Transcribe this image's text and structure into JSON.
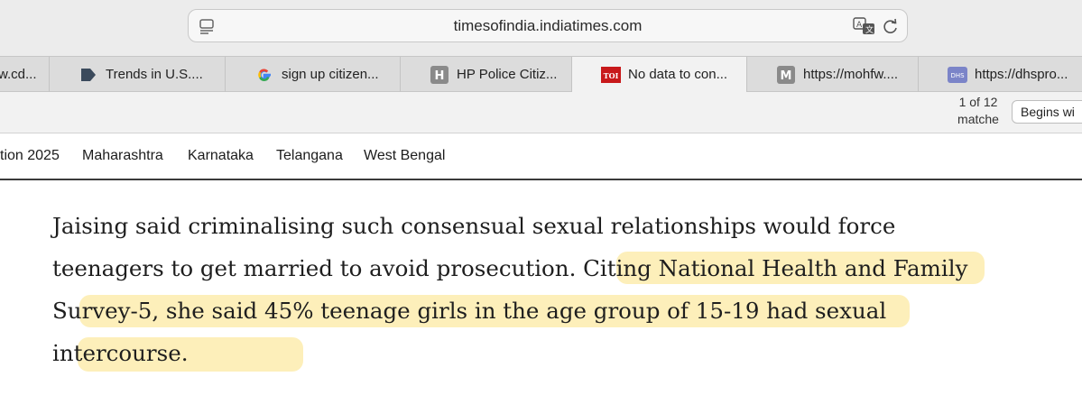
{
  "address_bar": {
    "url": "timesofindia.indiatimes.com"
  },
  "tabs": [
    {
      "label": "w.cd...",
      "icon": "",
      "active": false
    },
    {
      "label": "Trends in U.S....",
      "icon": "arrow-tag-icon",
      "active": false
    },
    {
      "label": "sign up citizen...",
      "icon": "google-icon",
      "active": false
    },
    {
      "label": "HP Police Citiz...",
      "icon": "h-icon",
      "active": false
    },
    {
      "label": "No data to con...",
      "icon": "toi-icon",
      "active": true
    },
    {
      "label": "https://mohfw....",
      "icon": "m-icon",
      "active": false
    },
    {
      "label": "https://dhspro...",
      "icon": "dhs-icon",
      "active": false
    }
  ],
  "tab_icon_text": {
    "h": "H",
    "toi": "TOI",
    "m": "M",
    "dhs": "DHS"
  },
  "find_bar": {
    "count_line1": "1 of 12",
    "count_line2": "matche",
    "option_label": "Begins wi"
  },
  "site_nav": {
    "items": [
      "tion 2025",
      "Maharashtra",
      "Karnataka",
      "Telangana",
      "West Bengal"
    ]
  },
  "article": {
    "lines": [
      "Jaising said criminalising such consensual sexual relationships would force",
      "teenagers to get married to avoid prosecution. Citing National Health and Family",
      "Survey-5, she said 45% teenage girls in the age group of 15-19 had sexual",
      "intercourse."
    ]
  },
  "colors": {
    "highlight": "#fce282",
    "toi_red": "#c8191b",
    "tab_active": "#f2f2f2"
  }
}
